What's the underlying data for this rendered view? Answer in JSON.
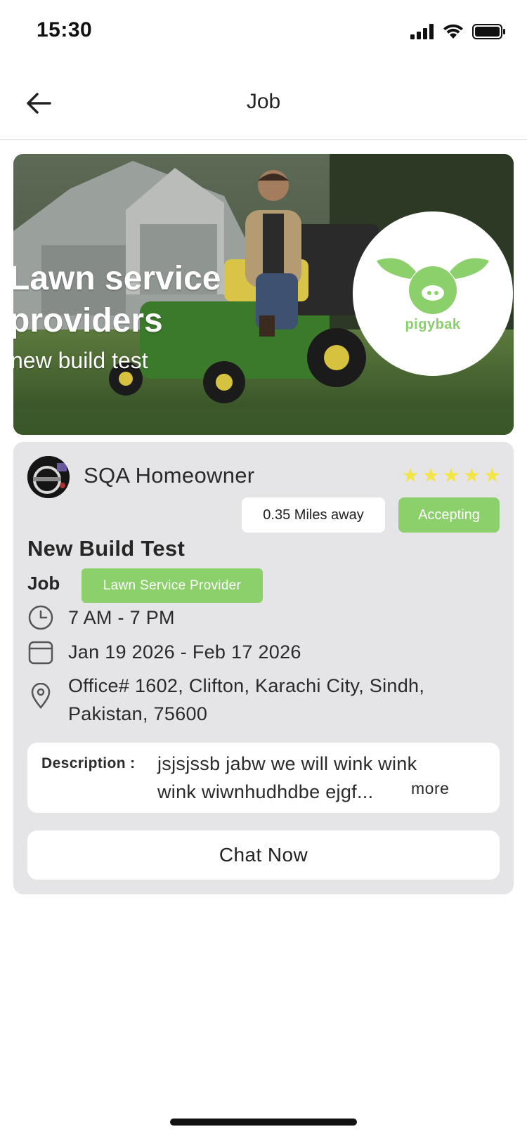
{
  "status_bar": {
    "time": "15:30"
  },
  "nav": {
    "title": "Job"
  },
  "hero": {
    "title": "Lawn service providers",
    "subtitle": "new build test",
    "brand_name": "pigybak"
  },
  "card": {
    "owner_name": "SQA Homeowner",
    "rating": 5,
    "distance": "0.35 Miles away",
    "status": "Accepting",
    "job_title": "New Build Test",
    "type_label": "Job",
    "category": "Lawn Service Provider",
    "time_range": "7 AM - 7 PM",
    "date_range": "Jan 19 2026  -  Feb 17 2026",
    "address_line1": "Office# 1602, Clifton, Karachi City, Sindh,",
    "address_line2": "Pakistan, 75600",
    "description_label": "Description :",
    "description_line1": "jsjsjssb jabw we will wink wink",
    "description_line2": "wink wiwnhudhdbe ejgf...",
    "more_label": "more",
    "chat_button": "Chat Now"
  },
  "colors": {
    "accent": "#8bd06b",
    "star": "#f3e545",
    "card_bg": "#e5e5e8"
  }
}
